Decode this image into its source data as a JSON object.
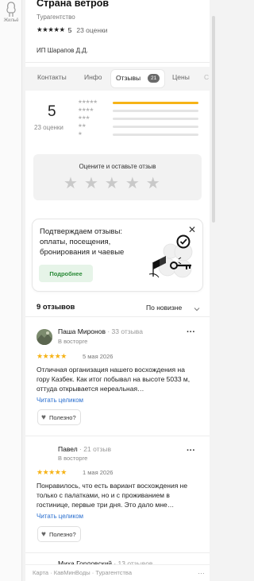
{
  "rail": {
    "item_label": "Жильё",
    "icon": "building-icon"
  },
  "header": {
    "name": "Страна ветров",
    "category": "Турагентство",
    "stars": "★★★★★",
    "rating": "5",
    "ratings_count": "23 оценки",
    "owner": "ИП Шарапов Д.Д."
  },
  "tabs": [
    {
      "label": "Контакты"
    },
    {
      "label": "Инфо"
    },
    {
      "label": "Отзывы",
      "badge": "21",
      "active": true
    },
    {
      "label": "Цены"
    },
    {
      "label": "С"
    }
  ],
  "summary": {
    "score": "5",
    "count_label": "23 оценки",
    "distribution": [
      {
        "stars": "★★★★★",
        "fraction": 1.0
      },
      {
        "stars": "★★★★",
        "fraction": 0.0
      },
      {
        "stars": "★★★",
        "fraction": 0.0
      },
      {
        "stars": "★★",
        "fraction": 0.0
      },
      {
        "stars": "★",
        "fraction": 0.0
      }
    ]
  },
  "rate_box": {
    "title": "Оцените и оставьте отзыв",
    "stars": [
      "★",
      "★",
      "★",
      "★",
      "★"
    ]
  },
  "promo": {
    "text": "Подтверждаем отзывы: оплаты, посещения, бронирования и чаевые",
    "button": "Подробнее",
    "close": "✕"
  },
  "reviews_header": {
    "count": "9 отзывов",
    "sort": "По новизне"
  },
  "reviews": [
    {
      "author": "Паша Миронов",
      "level": "33 отзыва",
      "status": "В восторге",
      "stars": "★★★★★",
      "date": "5 мая 2026",
      "text": "Отличная организация нашего восхождения на гору Казбек. Как итог побывал на высоте 5033 м, оттуда открывается нереальная…",
      "read_more": "Читать целиком",
      "useful": "Полезно?"
    },
    {
      "author": "Павел",
      "level": "21 отзыв",
      "status": "В восторге",
      "stars": "★★★★★",
      "date": "1 мая 2026",
      "text": "Понравилось, что есть вариант восхождения не только с палатками, но и с проживанием в гостинице, первые три дня. Это дало мне…",
      "read_more": "Читать целиком",
      "useful": "Полезно?"
    },
    {
      "author": "Миха Горловский",
      "level": "13 отзывов"
    }
  ],
  "footer": {
    "links": [
      "Карта",
      "КавМинВоды",
      "Турагентства"
    ],
    "separator": "·",
    "more": "…"
  }
}
